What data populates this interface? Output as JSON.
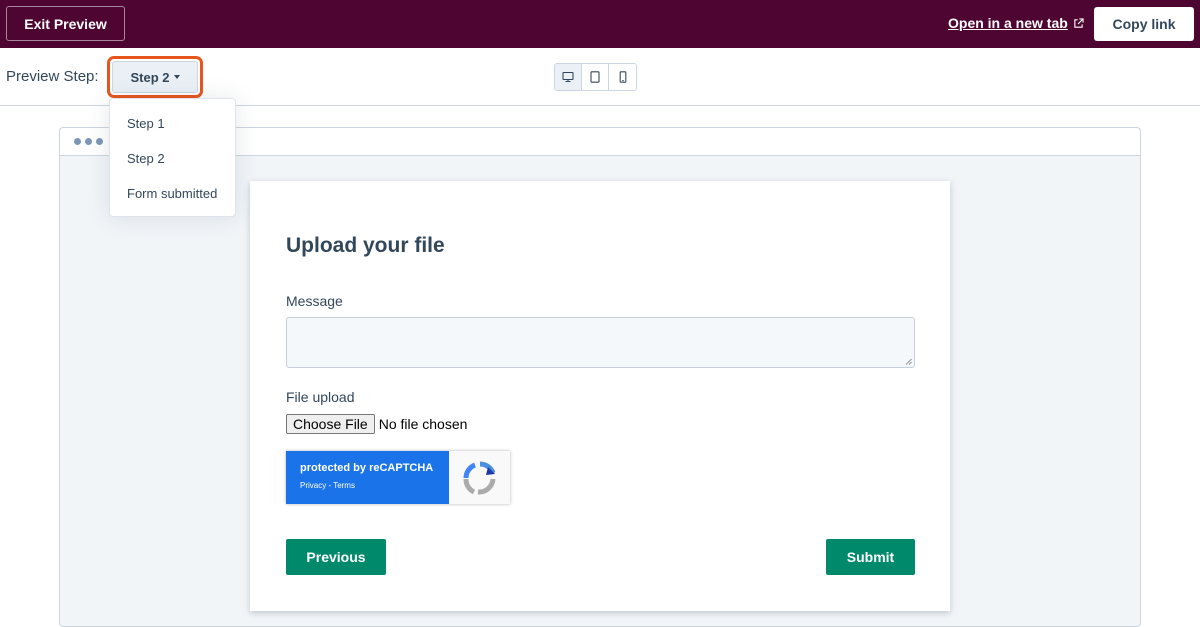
{
  "topbar": {
    "exit_label": "Exit Preview",
    "open_tab_label": "Open in a new tab",
    "copy_link_label": "Copy link"
  },
  "stepbar": {
    "label": "Preview Step:",
    "selected_step": "Step 2",
    "devices": [
      "desktop-icon",
      "tablet-icon",
      "mobile-icon"
    ],
    "active_device": "desktop"
  },
  "dropdown": {
    "items": [
      "Step 1",
      "Step 2",
      "Form submitted"
    ]
  },
  "form": {
    "title": "Upload your file",
    "message_label": "Message",
    "file_label": "File upload",
    "choose_file_label": "Choose File",
    "no_file_text": "No file chosen",
    "recaptcha_title": "protected by reCAPTCHA",
    "recaptcha_links": "Privacy - Terms",
    "previous_label": "Previous",
    "submit_label": "Submit"
  },
  "colors": {
    "topbar": "#4f0531",
    "accent_outline": "#e8561f",
    "button_green": "#00896b",
    "recaptcha_blue": "#1a73e8"
  }
}
